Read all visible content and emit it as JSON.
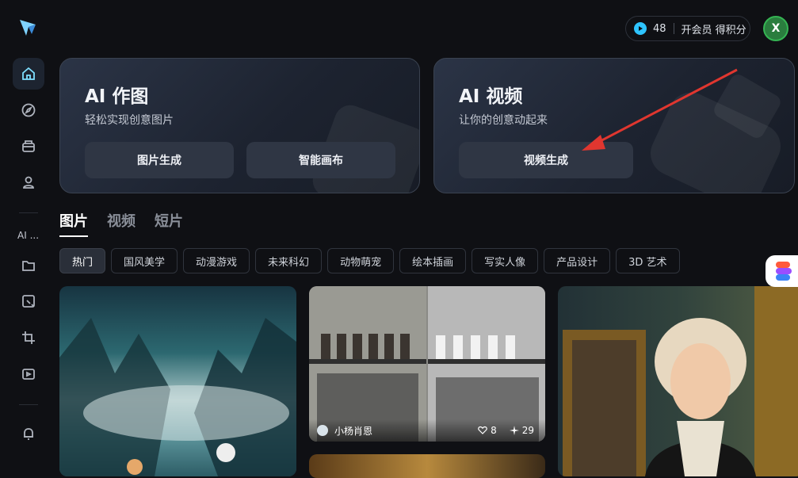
{
  "sidebar": {
    "section_label": "AI ...",
    "items": [
      {
        "icon": "home-icon"
      },
      {
        "icon": "compass-icon"
      },
      {
        "icon": "box-icon"
      },
      {
        "icon": "user-icon"
      },
      {
        "icon": "folder-icon"
      },
      {
        "icon": "image-add-icon"
      },
      {
        "icon": "crop-icon"
      },
      {
        "icon": "video-add-icon"
      },
      {
        "icon": "bell-icon"
      }
    ]
  },
  "topbar": {
    "points": "48",
    "vip_label": "开会员 得积分",
    "avatar_letter": "X"
  },
  "cards": {
    "image": {
      "title": "AI 作图",
      "subtitle": "轻松实现创意图片",
      "btn1": "图片生成",
      "btn2": "智能画布"
    },
    "video": {
      "title": "AI 视频",
      "subtitle": "让你的创意动起来",
      "btn1": "视频生成"
    }
  },
  "tabs": [
    "图片",
    "视频",
    "短片"
  ],
  "chips": [
    "热门",
    "国风美学",
    "动漫游戏",
    "未来科幻",
    "动物萌宠",
    "绘本插画",
    "写实人像",
    "产品设计",
    "3D 艺术"
  ],
  "gallery": {
    "item2": {
      "author": "小杨肖恩",
      "likes": "8",
      "remixes": "29"
    }
  },
  "colors": {
    "accent": "#2ec4ff",
    "arrow": "#e0362f"
  }
}
